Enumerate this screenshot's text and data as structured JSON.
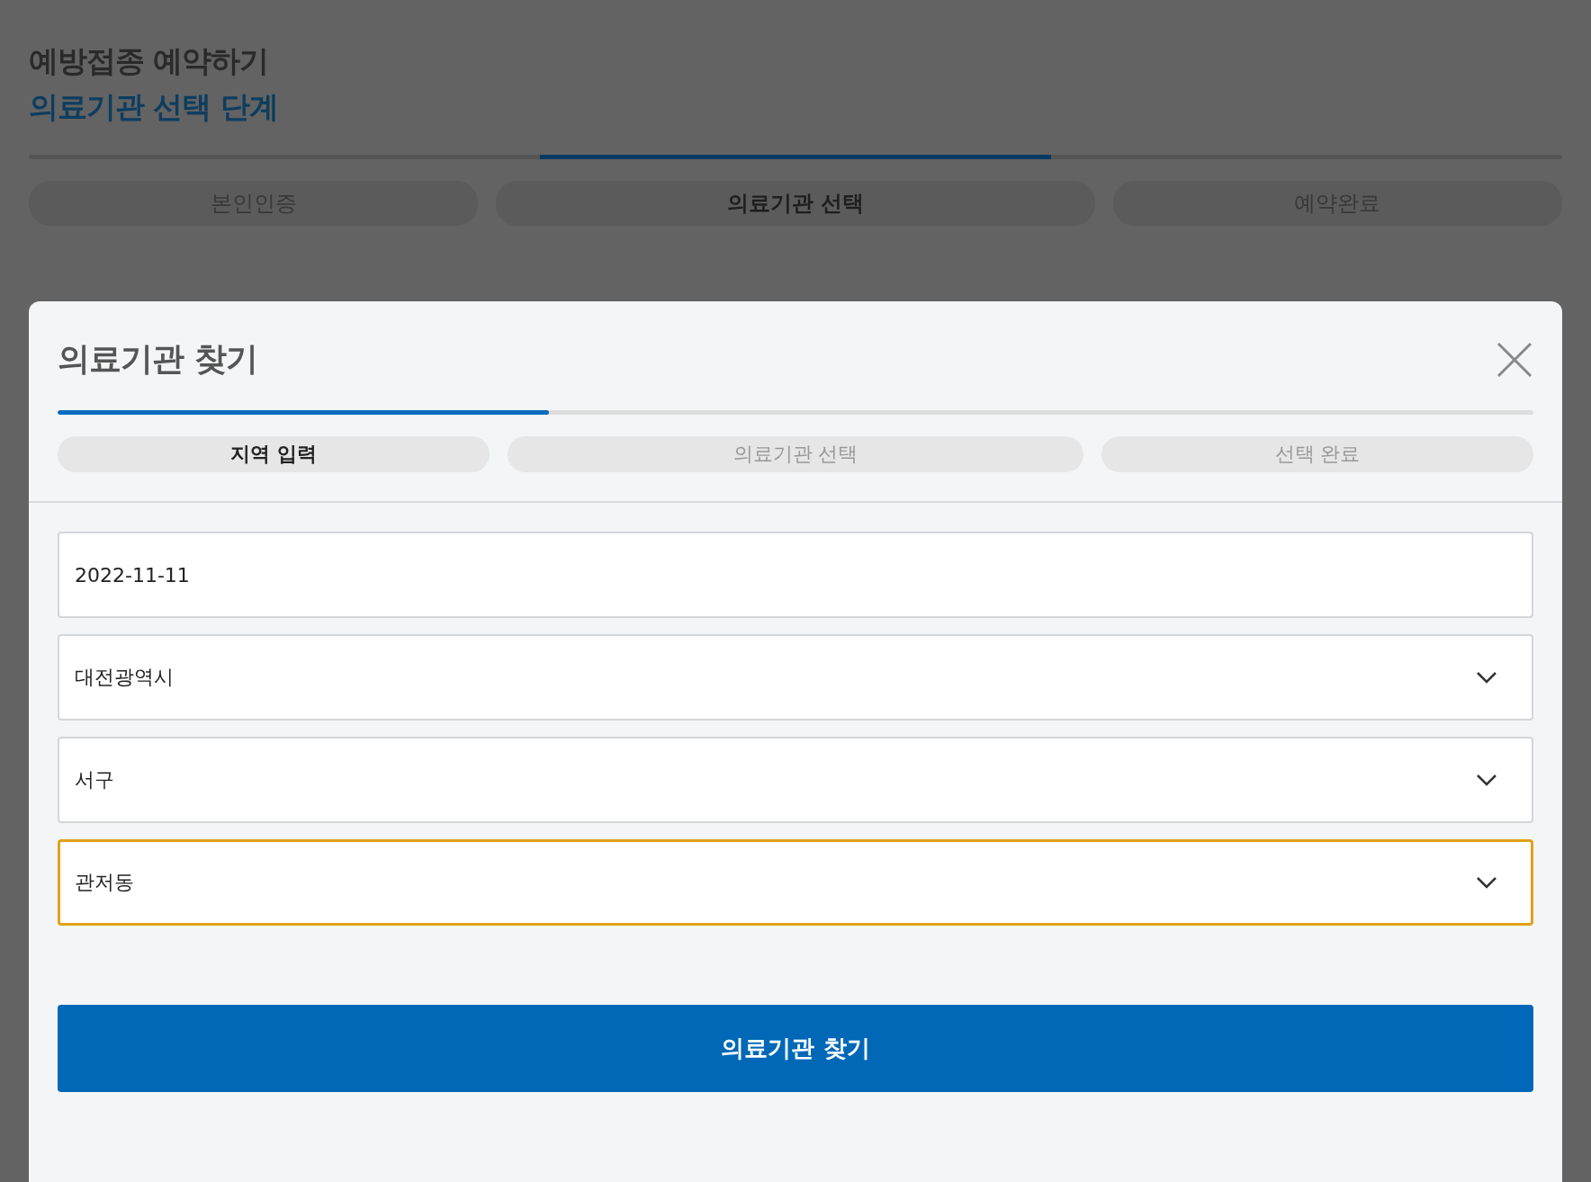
{
  "page": {
    "title": "예방접종 예약하기",
    "subtitle": "의료기관 선택 단계",
    "steps": [
      {
        "label": "본인인증",
        "selected": false
      },
      {
        "label": "의료기관 선택",
        "selected": true
      },
      {
        "label": "예약완료",
        "selected": false
      }
    ]
  },
  "dialog": {
    "title": "의료기관 찾기",
    "progress": {
      "level": 0.333
    },
    "steps": [
      {
        "label": "지역 입력",
        "selected": true
      },
      {
        "label": "의료기관 선택",
        "selected": false
      },
      {
        "label": "선택 완료",
        "selected": false
      }
    ],
    "fields": [
      {
        "kind": "date",
        "value": "2022-11-11",
        "focused": false
      },
      {
        "kind": "select",
        "value": "대전광역시",
        "focused": false
      },
      {
        "kind": "select",
        "value": "서구",
        "focused": false
      },
      {
        "kind": "select",
        "value": "관저동",
        "focused": true
      }
    ],
    "submit": "의료기관 찾기"
  }
}
